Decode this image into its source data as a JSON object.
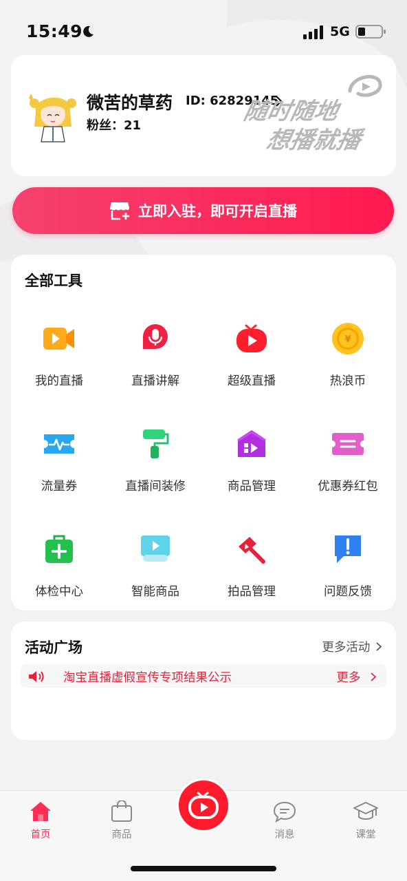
{
  "status": {
    "time": "15:49",
    "network": "5G"
  },
  "profile": {
    "username": "微苦的草药",
    "id": "ID: 62829145",
    "fans": "粉丝：21",
    "slogan_line1": "随时随地",
    "slogan_line2": "想播就播"
  },
  "join_button": {
    "label": "立即入驻，即可开启直播"
  },
  "tools": {
    "title": "全部工具",
    "items": [
      {
        "label": "我的直播",
        "icon": "video-camera-icon"
      },
      {
        "label": "直播讲解",
        "icon": "microphone-icon"
      },
      {
        "label": "超级直播",
        "icon": "tv-play-icon"
      },
      {
        "label": "热浪币",
        "icon": "coin-icon"
      },
      {
        "label": "流量券",
        "icon": "traffic-ticket-icon"
      },
      {
        "label": "直播间装修",
        "icon": "paint-roller-icon"
      },
      {
        "label": "商品管理",
        "icon": "store-video-icon"
      },
      {
        "label": "优惠券红包",
        "icon": "coupon-icon"
      },
      {
        "label": "体检中心",
        "icon": "medical-kit-icon"
      },
      {
        "label": "智能商品",
        "icon": "smart-screen-icon"
      },
      {
        "label": "拍品管理",
        "icon": "auction-hammer-icon"
      },
      {
        "label": "问题反馈",
        "icon": "feedback-icon"
      }
    ]
  },
  "activity": {
    "title": "活动广场",
    "more_label": "更多活动",
    "notice_text": "淘宝直播虚假宣传专项结果公示",
    "notice_more": "更多"
  },
  "tabbar": {
    "items": [
      {
        "label": "首页",
        "active": true
      },
      {
        "label": "商品",
        "active": false
      },
      {
        "label": "消息",
        "active": false
      },
      {
        "label": "课堂",
        "active": false
      }
    ]
  },
  "colors": {
    "accent": "#ff1a4f",
    "active_tab": "#ff2d55",
    "notice_red": "#e8213c"
  }
}
